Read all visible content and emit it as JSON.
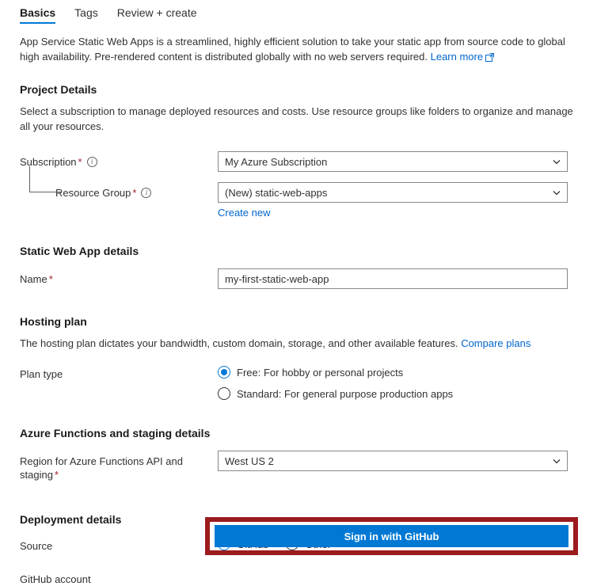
{
  "tabs": [
    {
      "label": "Basics",
      "active": true
    },
    {
      "label": "Tags",
      "active": false
    },
    {
      "label": "Review + create",
      "active": false
    }
  ],
  "intro": {
    "text": "App Service Static Web Apps is a streamlined, highly efficient solution to take your static app from source code to global high availability. Pre-rendered content is distributed globally with no web servers required.",
    "learn_more": "Learn more"
  },
  "project_details": {
    "title": "Project Details",
    "description": "Select a subscription to manage deployed resources and costs. Use resource groups like folders to organize and manage all your resources.",
    "subscription": {
      "label": "Subscription",
      "value": "My Azure Subscription"
    },
    "resource_group": {
      "label": "Resource Group",
      "value": "(New) static-web-apps",
      "create_new": "Create new"
    }
  },
  "static_web_app_details": {
    "title": "Static Web App details",
    "name": {
      "label": "Name",
      "value": "my-first-static-web-app"
    }
  },
  "hosting_plan": {
    "title": "Hosting plan",
    "description": "The hosting plan dictates your bandwidth, custom domain, storage, and other available features.",
    "compare_plans": "Compare plans",
    "plan_type_label": "Plan type",
    "options": [
      {
        "label": "Free: For hobby or personal projects",
        "checked": true
      },
      {
        "label": "Standard: For general purpose production apps",
        "checked": false
      }
    ]
  },
  "azure_functions": {
    "title": "Azure Functions and staging details",
    "region": {
      "label": "Region for Azure Functions API and staging",
      "value": "West US 2"
    }
  },
  "deployment_details": {
    "title": "Deployment details",
    "source_label": "Source",
    "source_options": [
      {
        "label": "GitHub",
        "checked": true
      },
      {
        "label": "Other",
        "checked": false
      }
    ],
    "github_account_label": "GitHub account",
    "sign_in_button": "Sign in with GitHub"
  },
  "colors": {
    "accent": "#0078d4",
    "link": "#0066cc",
    "required": "#a4262c",
    "annotation": "#9b1b1e"
  }
}
